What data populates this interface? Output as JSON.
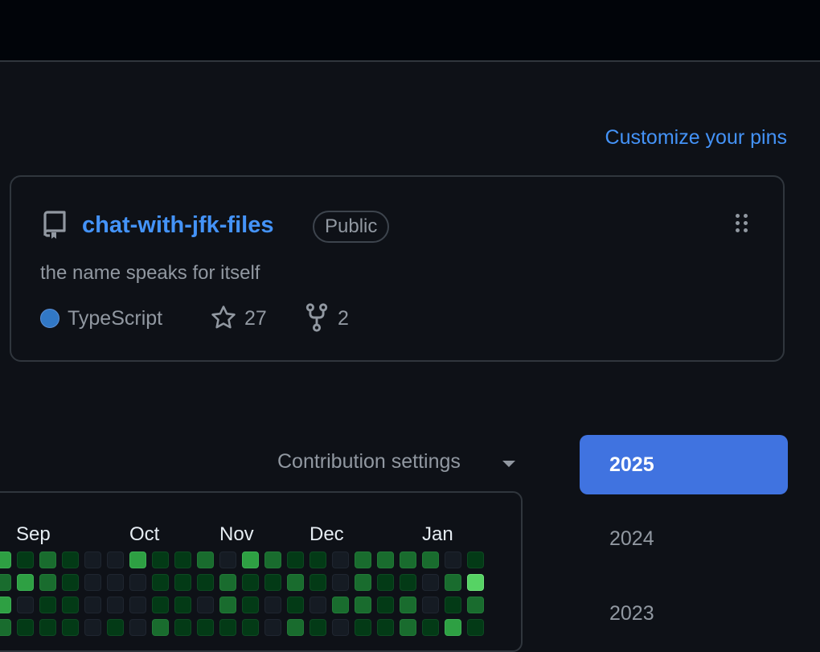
{
  "pins": {
    "customize_label": "Customize your pins",
    "repo": {
      "name": "chat-with-jfk-files",
      "visibility": "Public",
      "description": "the name speaks for itself",
      "language": "TypeScript",
      "language_color": "#3178c6",
      "stars": "27",
      "forks": "2"
    }
  },
  "contributions": {
    "settings_label": "Contribution settings",
    "months": [
      "Sep",
      "Oct",
      "Nov",
      "Dec",
      "Jan"
    ],
    "levels": [
      [
        3,
        1,
        2,
        1,
        0,
        0,
        3,
        1,
        1,
        2,
        0,
        3,
        2,
        1,
        1,
        0,
        2,
        2,
        2,
        2,
        0,
        1
      ],
      [
        2,
        3,
        2,
        1,
        0,
        0,
        0,
        1,
        1,
        1,
        2,
        1,
        1,
        2,
        1,
        0,
        2,
        1,
        1,
        0,
        2,
        4
      ],
      [
        3,
        0,
        1,
        1,
        0,
        0,
        0,
        1,
        1,
        0,
        2,
        1,
        0,
        1,
        0,
        2,
        2,
        1,
        2,
        0,
        1,
        2
      ],
      [
        2,
        1,
        1,
        1,
        0,
        1,
        0,
        2,
        1,
        1,
        1,
        1,
        0,
        2,
        1,
        0,
        1,
        1,
        2,
        1,
        3,
        1
      ]
    ],
    "level_colors": [
      "#151b23",
      "#033a16",
      "#196c2e",
      "#2ea043",
      "#56d364"
    ]
  },
  "years": [
    "2025",
    "2024",
    "2023"
  ]
}
